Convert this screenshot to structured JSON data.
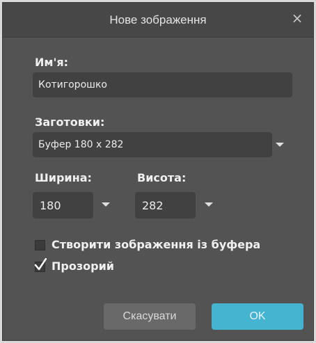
{
  "dialog": {
    "title": "Нове зображення",
    "close_symbol": "×"
  },
  "name_section": {
    "label": "Им'я:",
    "value": "Котигорошко"
  },
  "presets_section": {
    "label": "Заготовки:",
    "selected": "Буфер 180 x 282"
  },
  "width_section": {
    "label": "Ширина:",
    "value": "180"
  },
  "height_section": {
    "label": "Висота:",
    "value": "282"
  },
  "options": {
    "from_clipboard_label": "Створити зображення із буфера",
    "from_clipboard_checked": false,
    "transparent_label": "Прозорий",
    "transparent_checked": true
  },
  "buttons": {
    "cancel": "Скасувати",
    "ok": "OK"
  },
  "colors": {
    "accent": "#45b4d0",
    "background": "#535353"
  }
}
